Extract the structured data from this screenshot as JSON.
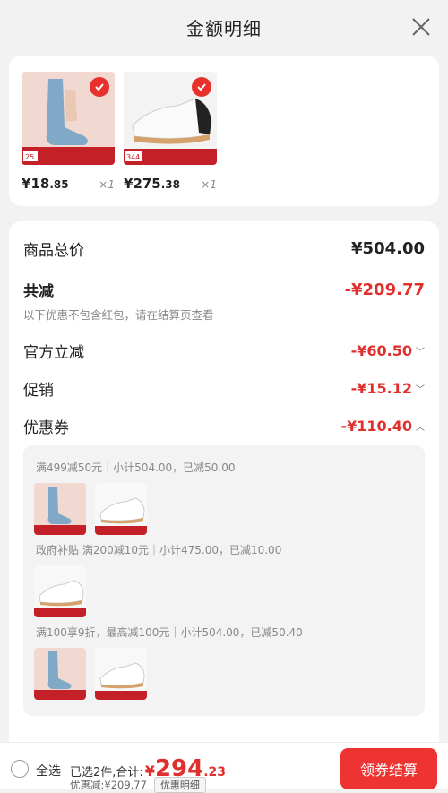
{
  "header": {
    "title": "金额明细"
  },
  "products": [
    {
      "name": "socks",
      "price_int": "18",
      "price_dec": ".85",
      "qty": "×1",
      "badge": "25"
    },
    {
      "name": "shoes",
      "price_int": "275",
      "price_dec": ".38",
      "qty": "×1",
      "badge": "344"
    }
  ],
  "currency": "¥",
  "details": {
    "total_label": "商品总价",
    "total_value": "¥504.00",
    "reduce_label": "共减",
    "reduce_value": "-¥209.77",
    "reduce_note": "以下优惠不包含红包，请在结算页查看",
    "official_label": "官方立减",
    "official_value": "-¥60.50",
    "promo_label": "促销",
    "promo_value": "-¥15.12",
    "coupon_label": "优惠券",
    "coupon_value": "-¥110.40"
  },
  "coupons": [
    {
      "text": "满499减50元｜小计504.00，已减50.00"
    },
    {
      "text": "政府补贴 满200减10元｜小计475.00，已减10.00"
    },
    {
      "text": "满100享9折，最高减100元｜小计504.00，已减50.40"
    }
  ],
  "footer": {
    "select_all": "全选",
    "selected_summary": "已选2件,合计:",
    "total_int": "294",
    "total_dec": ".23",
    "discount_text": "优惠减:¥209.77",
    "detail_link": "优惠明细",
    "checkout": "领券结算"
  },
  "colors": {
    "accent": "#e0302d",
    "button": "#ee3333"
  }
}
